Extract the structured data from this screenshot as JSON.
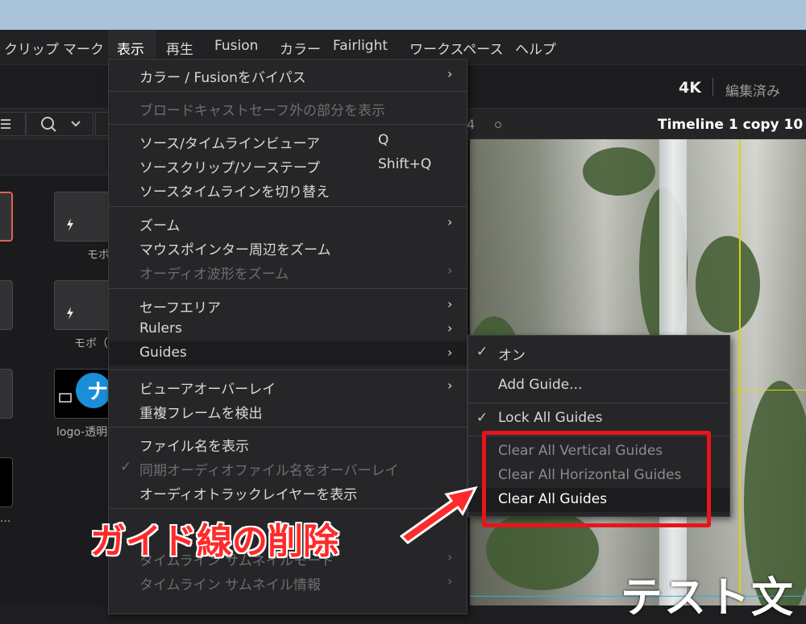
{
  "menubar": {
    "items": [
      "クリップ",
      "マーク",
      "表示",
      "再生",
      "Fusion",
      "カラー",
      "Fairlight",
      "ワークスペース",
      "ヘルプ"
    ]
  },
  "header": {
    "resolution": "4K",
    "edit_state": "編集済み"
  },
  "toolbar": {
    "timeline_name": "Timeline 1 copy 10",
    "partial_number": "4"
  },
  "media_pool": {
    "clip_labels": [
      "モボ",
      "モボ（共",
      "logo-透明",
      "..."
    ]
  },
  "view_menu": {
    "items": [
      {
        "label": "カラー / Fusionをバイパス",
        "shortcut": "",
        "arrow": "›",
        "enabled": true
      },
      {
        "label": "ブロードキャストセーフ外の部分を表示",
        "shortcut": "",
        "arrow": "",
        "enabled": false
      },
      {
        "label": "ソース/タイムラインビューア",
        "shortcut": "Q",
        "arrow": "",
        "enabled": true
      },
      {
        "label": "ソースクリップ/ソーステープ",
        "shortcut": "Shift+Q",
        "arrow": "",
        "enabled": true
      },
      {
        "label": "ソースタイムラインを切り替え",
        "shortcut": "",
        "arrow": "",
        "enabled": true
      },
      {
        "label": "ズーム",
        "shortcut": "",
        "arrow": "›",
        "enabled": true
      },
      {
        "label": "マウスポインター周辺をズーム",
        "shortcut": "",
        "arrow": "",
        "enabled": true
      },
      {
        "label": "オーディオ波形をズーム",
        "shortcut": "",
        "arrow": "›",
        "enabled": false
      },
      {
        "label": "セーフエリア",
        "shortcut": "",
        "arrow": "›",
        "enabled": true
      },
      {
        "label": "Rulers",
        "shortcut": "",
        "arrow": "›",
        "enabled": true
      },
      {
        "label": "Guides",
        "shortcut": "",
        "arrow": "›",
        "enabled": true
      },
      {
        "label": "ビューアオーバーレイ",
        "shortcut": "",
        "arrow": "›",
        "enabled": true
      },
      {
        "label": "重複フレームを検出",
        "shortcut": "",
        "arrow": "",
        "enabled": true
      },
      {
        "label": "ファイル名を表示",
        "shortcut": "",
        "arrow": "",
        "enabled": true
      },
      {
        "label": "同期オーディオファイル名をオーバーレイ",
        "shortcut": "",
        "arrow": "",
        "enabled": false,
        "checked": true
      },
      {
        "label": "オーディオトラックレイヤーを表示",
        "shortcut": "",
        "arrow": "",
        "enabled": true
      },
      {
        "label": "タイムライン サムネイルモード",
        "shortcut": "",
        "arrow": "›",
        "enabled": false
      },
      {
        "label": "タイムライン サムネイル情報",
        "shortcut": "",
        "arrow": "›",
        "enabled": false
      }
    ]
  },
  "guides_submenu": {
    "check_glyph": "✓",
    "items": [
      {
        "label": "オン",
        "checked": true,
        "enabled": true
      },
      {
        "label": "Add Guide...",
        "checked": false,
        "enabled": true
      },
      {
        "label": "Lock All Guides",
        "checked": true,
        "enabled": true
      },
      {
        "label": "Clear All Vertical Guides",
        "checked": false,
        "enabled": false
      },
      {
        "label": "Clear All Horizontal Guides",
        "checked": false,
        "enabled": false
      },
      {
        "label": "Clear All Guides",
        "checked": false,
        "enabled": true
      }
    ]
  },
  "annotation": {
    "text": "ガイド線の削除",
    "color": "#ff2a2a"
  },
  "viewer": {
    "caption": "テスト文"
  },
  "colors": {
    "guide": "#e0d20a",
    "highlight_box": "#e8141c"
  }
}
